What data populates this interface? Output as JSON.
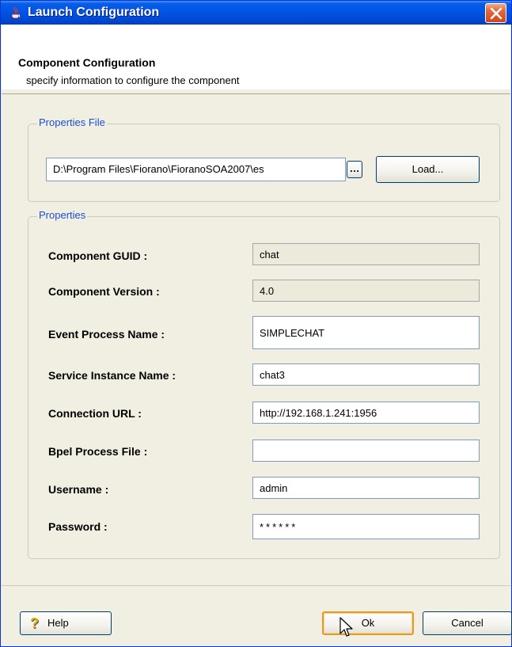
{
  "window": {
    "title": "Launch Configuration",
    "icon": "java-cup-icon"
  },
  "header": {
    "title": "Component Configuration",
    "subtitle": "specify information to configure the component"
  },
  "properties_file_group": {
    "legend": "Properties File",
    "path_value": "D:\\Program Files\\Fiorano\\FioranoSOA2007\\es",
    "browse_label": "…",
    "load_label": "Load..."
  },
  "properties_group": {
    "legend": "Properties",
    "fields": [
      {
        "label": "Component GUID :",
        "value": "chat",
        "readonly": true
      },
      {
        "label": "Component Version :",
        "value": "4.0",
        "readonly": true
      },
      {
        "label": "Event Process Name :",
        "value": "SIMPLECHAT",
        "readonly": false
      },
      {
        "label": "Service Instance Name :",
        "value": "chat3",
        "readonly": false
      },
      {
        "label": "Connection URL :",
        "value": "http://192.168.1.241:1956",
        "readonly": false
      },
      {
        "label": "Bpel Process File :",
        "value": "",
        "readonly": false
      },
      {
        "label": "Username :",
        "value": "admin",
        "readonly": false
      },
      {
        "label": "Password :",
        "value": "******",
        "readonly": false
      }
    ]
  },
  "buttons": {
    "help": "Help",
    "ok": "Ok",
    "cancel": "Cancel"
  },
  "colors": {
    "titlebar": "#0055e5",
    "legend": "#1b4ed6",
    "dialog_bg": "#f1efe2"
  }
}
